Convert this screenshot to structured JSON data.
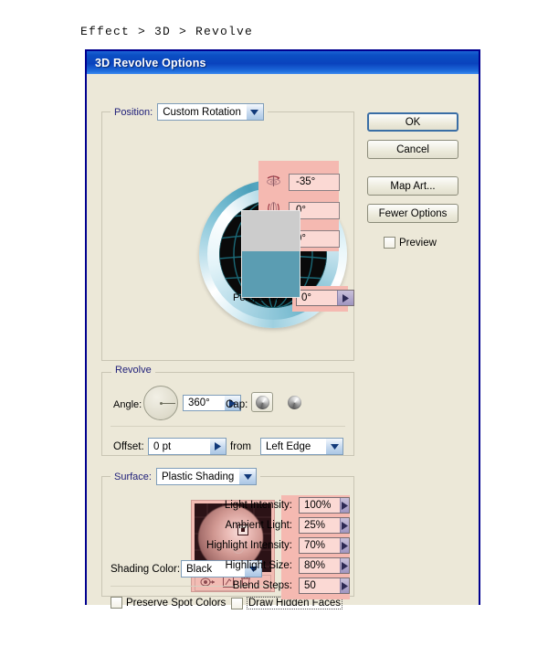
{
  "breadcrumb": "Effect  >  3D  >  Revolve",
  "dialog": {
    "title": "3D Revolve Options"
  },
  "buttons": {
    "ok": "OK",
    "cancel": "Cancel",
    "map_art": "Map Art...",
    "fewer_options": "Fewer Options",
    "preview_label": "Preview",
    "preview_checked": false
  },
  "position": {
    "group_label": "Position:",
    "preset": "Custom Rotation",
    "rotations": [
      {
        "axis": "x-axis-rotation",
        "icon": "rotate-x-icon",
        "value": "-35°"
      },
      {
        "axis": "y-axis-rotation",
        "icon": "rotate-y-icon",
        "value": "0°"
      },
      {
        "axis": "z-axis-rotation",
        "icon": "rotate-z-icon",
        "value": "0°"
      }
    ],
    "perspective_label": "Perspective:",
    "perspective_value": "0°"
  },
  "revolve": {
    "group_label": "Revolve",
    "angle_label": "Angle:",
    "angle_value": "360°",
    "cap_label": "Cap:",
    "cap_solid_selected": true,
    "offset_label": "Offset:",
    "offset_value": "0 pt",
    "from_label": "from",
    "from_value": "Left Edge"
  },
  "surface": {
    "group_label": "Surface:",
    "shading": "Plastic Shading",
    "tools": [
      {
        "name": "move-light-icon"
      },
      {
        "name": "new-light-icon"
      },
      {
        "name": "delete-light-icon"
      }
    ],
    "params": [
      {
        "label": "Light Intensity:",
        "value": "100%"
      },
      {
        "label": "Ambient Light:",
        "value": "25%"
      },
      {
        "label": "Highlight Intensity:",
        "value": "70%"
      },
      {
        "label": "Highlight Size:",
        "value": "80%"
      },
      {
        "label": "Blend Steps:",
        "value": "50"
      }
    ],
    "shading_color_label": "Shading Color:",
    "shading_color_value": "Black",
    "preserve_spot_colors_label": "Preserve Spot Colors",
    "preserve_spot_colors_checked": false,
    "draw_hidden_faces_label": "Draw Hidden Faces",
    "draw_hidden_faces_checked": false
  },
  "colors": {
    "titlebar": "#0b4fc4",
    "dialog_border": "#00008f",
    "dialog_bg": "#ece8d8",
    "highlight_pink": "#f5b9b1",
    "field_pink": "#fbd9d4",
    "group_label_blue": "#21217a",
    "artwork_gray": "#cccccc",
    "artwork_teal": "#5b9db2"
  }
}
